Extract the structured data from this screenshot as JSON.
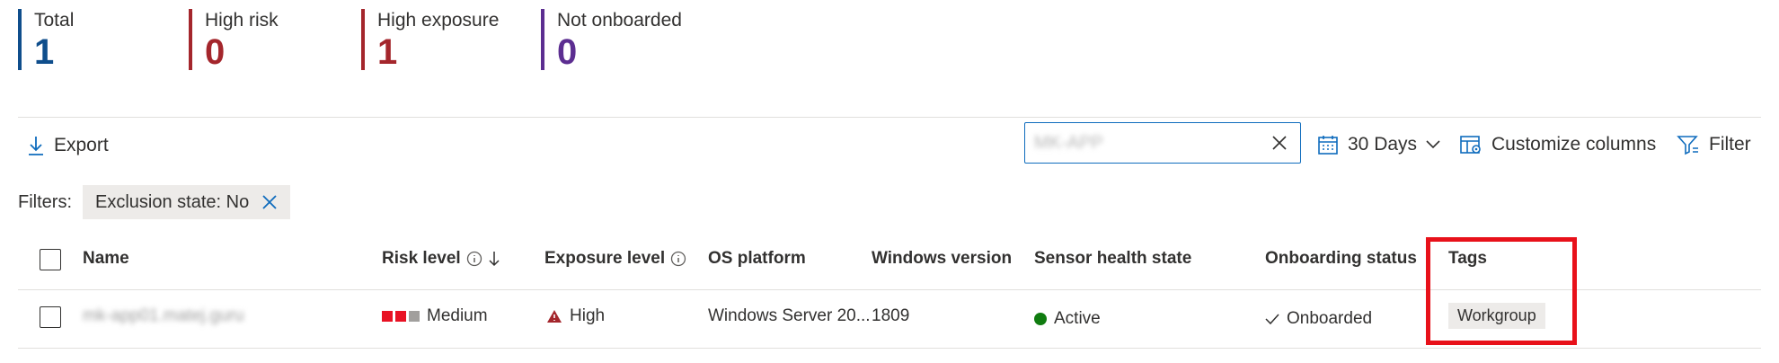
{
  "summary": {
    "total": {
      "label": "Total",
      "value": "1"
    },
    "high_risk": {
      "label": "High risk",
      "value": "0"
    },
    "high_exposure": {
      "label": "High exposure",
      "value": "1"
    },
    "not_onboarded": {
      "label": "Not onboarded",
      "value": "0"
    }
  },
  "toolbar": {
    "export_label": "Export",
    "search_value": "MK-APP",
    "time_range_label": "30 Days",
    "customize_label": "Customize columns",
    "filter_label": "Filter"
  },
  "filters": {
    "label": "Filters:",
    "chips": [
      {
        "label": "Exclusion state: No"
      }
    ]
  },
  "table": {
    "columns": {
      "name": "Name",
      "risk_level": "Risk level",
      "exposure_level": "Exposure level",
      "os_platform": "OS platform",
      "windows_version": "Windows version",
      "sensor_health": "Sensor health state",
      "onboarding_status": "Onboarding status",
      "tags": "Tags"
    },
    "rows": [
      {
        "name": "mk-app01.matej.guru",
        "risk_level": "Medium",
        "exposure_level": "High",
        "os_platform": "Windows Server 20...",
        "windows_version": "1809",
        "sensor_health": "Active",
        "onboarding_status": "Onboarded",
        "tag": "Workgroup"
      }
    ]
  },
  "colors": {
    "total": "#0f4e8c",
    "risk": "#a4262c",
    "not_onboarded": "#5c2e91",
    "accent": "#0f6cbd",
    "risk_bar_on": "#e81123",
    "risk_bar_off": "#a19f9d",
    "active_dot": "#107c10",
    "highlight": "#e8111a"
  }
}
